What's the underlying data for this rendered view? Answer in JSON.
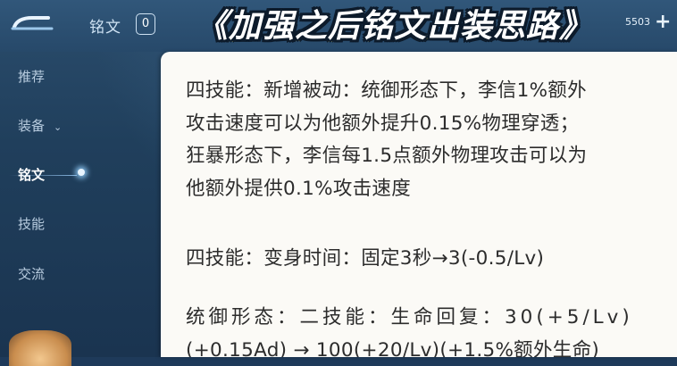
{
  "header": {
    "tab_title": "铭文",
    "tab_count": "0",
    "coin_value": "5503",
    "add_label": "+",
    "headline": "《加强之后铭文出装思路》"
  },
  "sidebar": {
    "items": [
      {
        "label": "推荐"
      },
      {
        "label": "装备"
      },
      {
        "label": "铭文"
      },
      {
        "label": "技能"
      },
      {
        "label": "交流"
      }
    ]
  },
  "content": {
    "paragraph1": [
      "四技能：新增被动：统御形态下，李信1%额外",
      "攻击速度可以为他额外提升0.15%物理穿透；",
      "狂暴形态下，李信每1.5点额外物理攻击可以为",
      "他额外提供0.1%攻击速度"
    ],
    "paragraph2": [
      "四技能：变身时间：固定3秒→3(-0.5/Lv)"
    ],
    "paragraph3": [
      "统御形态：二技能：生命回复：30(+5/Lv)",
      "(+0.15Ad) → 100(+20/Lv)(+1.5%额外生命)"
    ]
  },
  "colors": {
    "accent": "#f3d23a",
    "panel_bg": "#fbfaf6",
    "sidebar_text": "#b9cde0"
  }
}
